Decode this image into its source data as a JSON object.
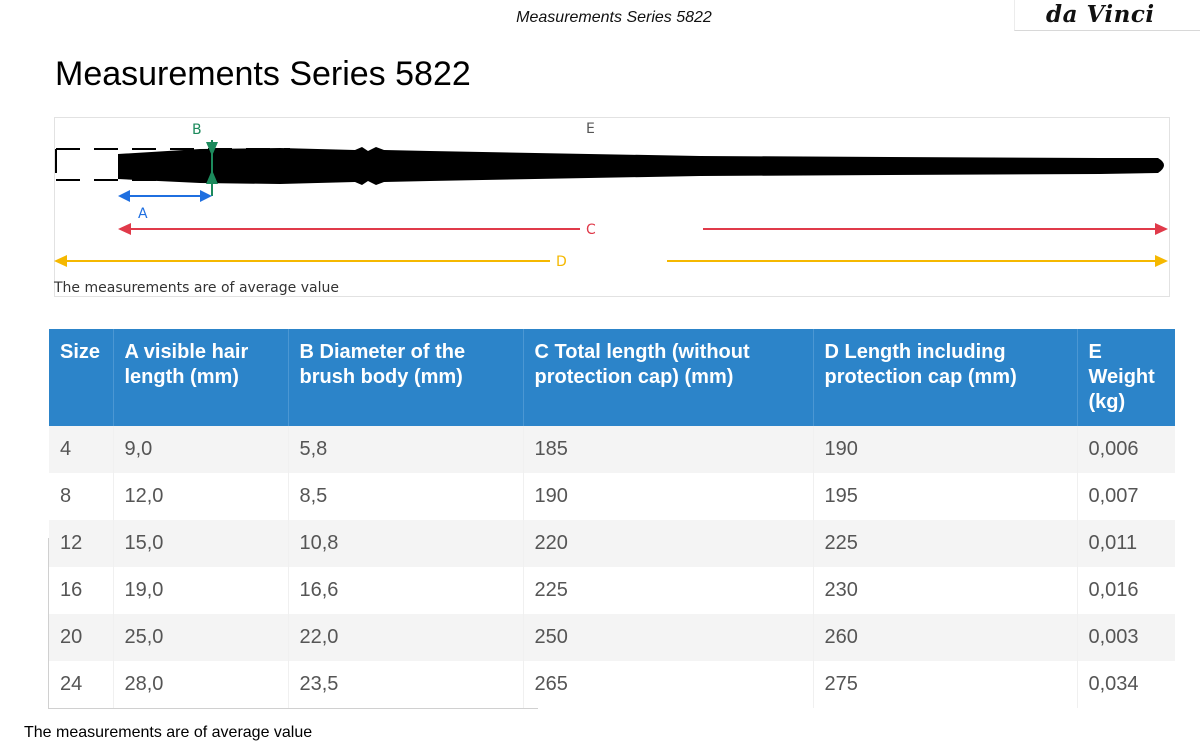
{
  "header": {
    "title": "Measurements Series 5822",
    "logo_text": "da Vinci"
  },
  "page_title": "Measurements Series 5822",
  "diagram": {
    "labels": {
      "a": "A",
      "b": "B",
      "c": "C",
      "d": "D",
      "e": "E"
    },
    "note": "The measurements are of average value",
    "colors": {
      "a": "#1f6fe0",
      "b": "#1c8a5c",
      "c": "#e03a4a",
      "d": "#f5b800",
      "brush": "#000000"
    }
  },
  "table": {
    "header_color": "#2c84c9",
    "columns": [
      "Size",
      "A visible hair length (mm)",
      "B Diameter of the brush body (mm)",
      "C Total length (without protection cap) (mm)",
      "D Length including protection cap (mm)",
      "E Weight (kg)"
    ],
    "rows": [
      [
        "4",
        "9,0",
        "5,8",
        "185",
        "190",
        "0,006"
      ],
      [
        "8",
        "12,0",
        "8,5",
        "190",
        "195",
        "0,007"
      ],
      [
        "12",
        "15,0",
        "10,8",
        "220",
        "225",
        "0,011"
      ],
      [
        "16",
        "19,0",
        "16,6",
        "225",
        "230",
        "0,016"
      ],
      [
        "20",
        "25,0",
        "22,0",
        "250",
        "260",
        "0,003"
      ],
      [
        "24",
        "28,0",
        "23,5",
        "265",
        "275",
        "0,034"
      ]
    ]
  },
  "footer_note": "The measurements are of average value"
}
